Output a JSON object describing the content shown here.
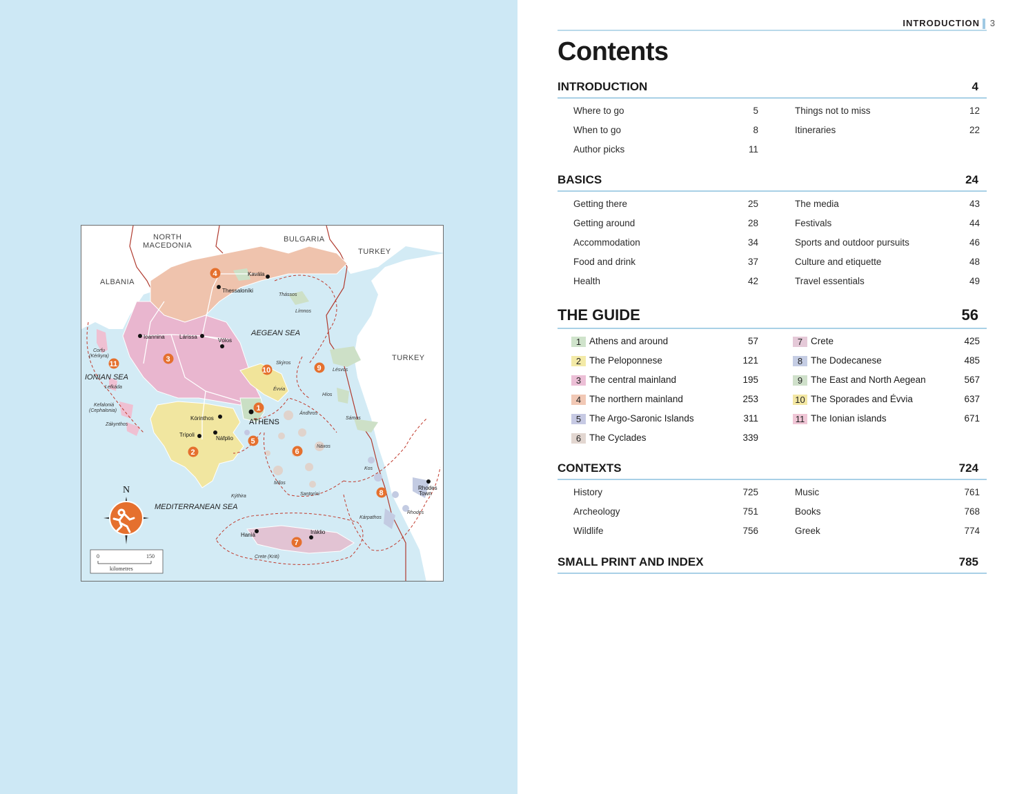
{
  "running_head": {
    "label": "INTRODUCTION",
    "page": "3"
  },
  "title": "Contents",
  "sections": {
    "introduction": {
      "label": "INTRODUCTION",
      "page": "4",
      "col_a": [
        {
          "label": "Where to go",
          "page": "5"
        },
        {
          "label": "When to go",
          "page": "8"
        },
        {
          "label": "Author picks",
          "page": "11"
        }
      ],
      "col_b": [
        {
          "label": "Things not to miss",
          "page": "12"
        },
        {
          "label": "Itineraries",
          "page": "22"
        }
      ]
    },
    "basics": {
      "label": "BASICS",
      "page": "24",
      "col_a": [
        {
          "label": "Getting there",
          "page": "25"
        },
        {
          "label": "Getting around",
          "page": "28"
        },
        {
          "label": "Accommodation",
          "page": "34"
        },
        {
          "label": "Food and drink",
          "page": "37"
        },
        {
          "label": "Health",
          "page": "42"
        }
      ],
      "col_b": [
        {
          "label": "The media",
          "page": "43"
        },
        {
          "label": "Festivals",
          "page": "44"
        },
        {
          "label": "Sports and outdoor pursuits",
          "page": "46"
        },
        {
          "label": "Culture and etiquette",
          "page": "48"
        },
        {
          "label": "Travel essentials",
          "page": "49"
        }
      ]
    },
    "guide": {
      "label": "THE GUIDE",
      "page": "56",
      "col_a": [
        {
          "num": "1",
          "label": "Athens and around",
          "page": "57",
          "color": "#cfe3cb"
        },
        {
          "num": "2",
          "label": "The Peloponnese",
          "page": "121",
          "color": "#f3eaa7"
        },
        {
          "num": "3",
          "label": "The central mainland",
          "page": "195",
          "color": "#ecbfd6"
        },
        {
          "num": "4",
          "label": "The northern mainland",
          "page": "253",
          "color": "#f1c8b5"
        },
        {
          "num": "5",
          "label": "The Argo-Saronic Islands",
          "page": "311",
          "color": "#c6c9e3"
        },
        {
          "num": "6",
          "label": "The Cyclades",
          "page": "339",
          "color": "#e2d6d0"
        }
      ],
      "col_b": [
        {
          "num": "7",
          "label": "Crete",
          "page": "425",
          "color": "#e5c9d8"
        },
        {
          "num": "8",
          "label": "The Dodecanese",
          "page": "485",
          "color": "#c5cde4"
        },
        {
          "num": "9",
          "label": "The East and North Aegean",
          "page": "567",
          "color": "#cfe0ca"
        },
        {
          "num": "10",
          "label": "The Sporades and Évvia",
          "page": "637",
          "color": "#f3e7a3"
        },
        {
          "num": "11",
          "label": "The Ionian islands",
          "page": "671",
          "color": "#f0c6d6"
        }
      ]
    },
    "contexts": {
      "label": "CONTEXTS",
      "page": "724",
      "col_a": [
        {
          "label": "History",
          "page": "725"
        },
        {
          "label": "Archeology",
          "page": "751"
        },
        {
          "label": "Wildlife",
          "page": "756"
        }
      ],
      "col_b": [
        {
          "label": "Music",
          "page": "761"
        },
        {
          "label": "Books",
          "page": "768"
        },
        {
          "label": "Greek",
          "page": "774"
        }
      ]
    },
    "small_print": {
      "label": "SMALL PRINT AND INDEX",
      "page": "785"
    }
  },
  "map": {
    "countries": {
      "north_macedonia_1": "NORTH",
      "north_macedonia_2": "MACEDONIA",
      "bulgaria": "BULGARIA",
      "turkey_north": "TURKEY",
      "albania": "ALBANIA",
      "turkey_east": "TURKEY"
    },
    "seas": {
      "aegean": "AEGEAN SEA",
      "ionian": "IONIAN SEA",
      "mediterranean": "MEDITERRANEAN SEA"
    },
    "cities": {
      "kavala": "Kavála",
      "thessaloniki": "Thessaloníki",
      "ioannina": "Ioannina",
      "larissa": "Lárissa",
      "volos": "Vólos",
      "athens": "ATHENS",
      "korinthos": "Kórinthos",
      "tripoli": "Trípoli",
      "nafplio": "Náfplio",
      "hania": "Haniá",
      "iraklio": "Iráklio",
      "rhodes_town_1": "Rhodes",
      "rhodes_town_2": "Town"
    },
    "islands": {
      "thassos": "Thássos",
      "limnos": "Límnos",
      "corfu_1": "Corfu",
      "corfu_2": "(Kérkyra)",
      "lefkada": "Lefkáda",
      "skyros": "Skýros",
      "lesvos": "Lésvos",
      "evvia": "Évvia",
      "hios": "Híos",
      "kefalonia_1": "Kefaloniá",
      "kefalonia_2": "(Cephalonia)",
      "zakynthos": "Zákynthos",
      "andros": "Ándhros",
      "samos": "Sámos",
      "naxos": "Náxos",
      "kos": "Kos",
      "milos": "Mílos",
      "santorini": "Santoríni",
      "kythira": "Kýthira",
      "rhodes": "Rhodes",
      "karpathos": "Kárpathos",
      "crete": "Crete (Kriti)"
    },
    "region_badges": [
      "1",
      "2",
      "3",
      "4",
      "5",
      "6",
      "7",
      "8",
      "9",
      "10",
      "11"
    ],
    "compass_letter": "N",
    "scale": {
      "start": "0",
      "end": "150",
      "unit": "kilometres"
    }
  }
}
